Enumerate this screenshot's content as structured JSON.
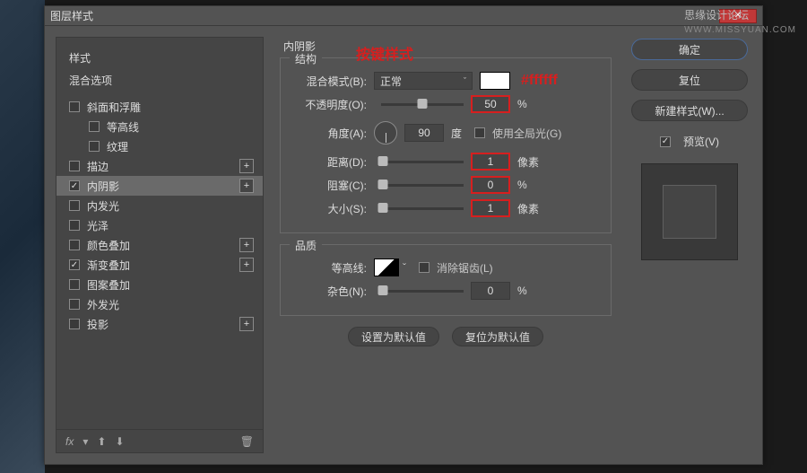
{
  "watermark": {
    "main": "思缘设计论坛",
    "sub": "WWW.MISSYUAN.COM"
  },
  "dialog": {
    "title": "图层样式"
  },
  "annotations": {
    "title_note": "按键样式",
    "color_note": "#ffffff"
  },
  "left": {
    "header1": "样式",
    "header2": "混合选项",
    "items": [
      {
        "label": "斜面和浮雕",
        "checked": false,
        "plus": false,
        "child": false
      },
      {
        "label": "等高线",
        "checked": false,
        "plus": false,
        "child": true
      },
      {
        "label": "纹理",
        "checked": false,
        "plus": false,
        "child": true
      },
      {
        "label": "描边",
        "checked": false,
        "plus": true,
        "child": false
      },
      {
        "label": "内阴影",
        "checked": true,
        "plus": true,
        "child": false,
        "selected": true
      },
      {
        "label": "内发光",
        "checked": false,
        "plus": false,
        "child": false
      },
      {
        "label": "光泽",
        "checked": false,
        "plus": false,
        "child": false
      },
      {
        "label": "颜色叠加",
        "checked": false,
        "plus": true,
        "child": false
      },
      {
        "label": "渐变叠加",
        "checked": true,
        "plus": true,
        "child": false
      },
      {
        "label": "图案叠加",
        "checked": false,
        "plus": false,
        "child": false
      },
      {
        "label": "外发光",
        "checked": false,
        "plus": false,
        "child": false
      },
      {
        "label": "投影",
        "checked": false,
        "plus": true,
        "child": false
      }
    ],
    "footer_fx": "fx"
  },
  "mid": {
    "title": "内阴影",
    "group1": "结构",
    "group2": "品质",
    "blend_label": "混合模式(B):",
    "blend_value": "正常",
    "opacity_label": "不透明度(O):",
    "opacity_value": "50",
    "opacity_unit": "%",
    "angle_label": "角度(A):",
    "angle_value": "90",
    "angle_unit": "度",
    "global_label": "使用全局光(G)",
    "distance_label": "距离(D):",
    "distance_value": "1",
    "distance_unit": "像素",
    "choke_label": "阻塞(C):",
    "choke_value": "0",
    "choke_unit": "%",
    "size_label": "大小(S):",
    "size_value": "1",
    "size_unit": "像素",
    "contour_label": "等高线:",
    "antialias_label": "消除锯齿(L)",
    "noise_label": "杂色(N):",
    "noise_value": "0",
    "noise_unit": "%",
    "btn_default": "设置为默认值",
    "btn_reset": "复位为默认值"
  },
  "right": {
    "ok": "确定",
    "cancel": "复位",
    "new_style": "新建样式(W)...",
    "preview": "预览(V)"
  }
}
